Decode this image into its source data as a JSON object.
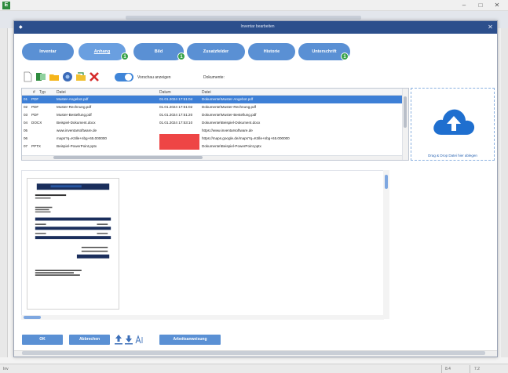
{
  "app": {
    "logo": "E",
    "minimize": "–",
    "maximize": "□",
    "close": "✕"
  },
  "status": {
    "left": "Inv",
    "mid": "8.4",
    "right": "7.2"
  },
  "dialog": {
    "title": "Inventar bearbeiten",
    "icon": "◆",
    "close": "✕"
  },
  "tabs": [
    {
      "label": "Inventar",
      "badge": ""
    },
    {
      "label": "Anhang",
      "badge": "1"
    },
    {
      "label": "Bild",
      "badge": "1"
    },
    {
      "label": "Zusatzfelder",
      "badge": ""
    },
    {
      "label": "Historie",
      "badge": ""
    },
    {
      "label": "Unterschrift",
      "badge": "1"
    }
  ],
  "toolbar": {
    "toggle_label": "Vorschau anzeigen",
    "docs_label": "Dokumente:"
  },
  "table": {
    "headers": [
      "#",
      "Typ",
      "Datei",
      "Datum",
      "Datei"
    ],
    "rows": [
      {
        "num": "01",
        "type": "PDF",
        "file": "Muster-Angebot.pdf",
        "date": "01.01.2024 17:51:04",
        "path": "Dokumente\\Muster-Angebot.pdf"
      },
      {
        "num": "02",
        "type": "PDF",
        "file": "Muster-Rechnung.pdf",
        "date": "01.01.2024 17:51:02",
        "path": "Dokumente\\Muster-Rechnung.pdf"
      },
      {
        "num": "03",
        "type": "PDF",
        "file": "Muster-Bestellung.pdf",
        "date": "01.01.2024 17:51:20",
        "path": "Dokumente\\Muster-Bestellung.pdf"
      },
      {
        "num": "04",
        "type": "DOCX",
        "file": "Beispiel-Dokument.docx",
        "date": "01.01.2024 17:53:10",
        "path": "Dokumente\\Beispiel-Dokument.docx"
      },
      {
        "num": "05",
        "type": "",
        "file": "www.inventarsoftware.de",
        "date": "",
        "path": "https://www.inventarsoftware.de"
      },
      {
        "num": "06",
        "type": "",
        "file": "maps?q=Kölle+nbg+65.000000",
        "date": "",
        "path": "https://maps.google.de/maps?q=Kölle+nbg+65.000000"
      },
      {
        "num": "07",
        "type": "PPTX",
        "file": "Beispiel-PowerPoint.pptx",
        "date": "01.01.2024 17:52:18",
        "path": "Dokumente\\Beispiel-PowerPoint.pptx"
      }
    ]
  },
  "upload": {
    "text": "Drag & Drop Datei hier ablegen"
  },
  "buttons": {
    "ok": "OK",
    "cancel": "Abbrechen",
    "action": "Arbeitsanweisung"
  },
  "colors": {
    "accent": "#5a90d4",
    "titlebar": "#2c4f8c",
    "selection": "#3d7fd6",
    "badge": "#37a24a",
    "redacted": "#ee4545"
  }
}
